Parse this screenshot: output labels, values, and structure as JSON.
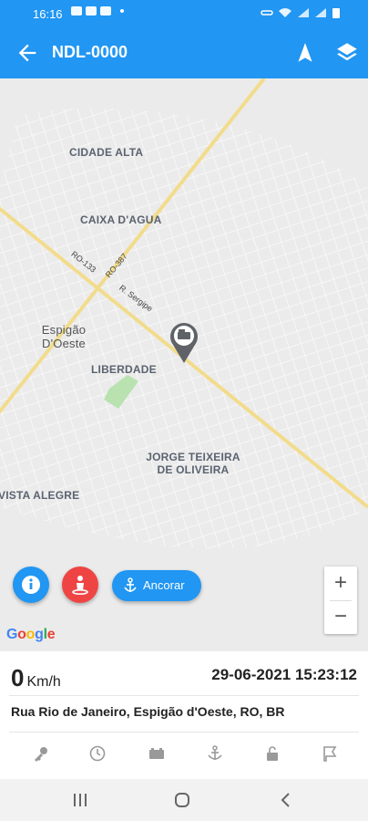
{
  "status_bar": {
    "time": "16:16"
  },
  "app_bar": {
    "title": "NDL-0000"
  },
  "map": {
    "labels": {
      "cidade_alta": "CIDADE ALTA",
      "caixa_dagua": "CAIXA D'AGUA",
      "espigao_doeste": "Espigão D'Oeste",
      "liberdade": "LIBERDADE",
      "jorge_teixeira": "JORGE TEIXEIRA DE OLIVEIRA",
      "vista_alegre": "VISTA ALEGRE"
    },
    "road_labels": {
      "ro133": "RO-133",
      "ro387": "RO-387",
      "r_sergipe": "R. Sergipe"
    },
    "google_logo": "Google",
    "anchor_button": "Ancorar",
    "zoom_in": "+",
    "zoom_out": "−"
  },
  "vehicle": {
    "speed_value": "0",
    "speed_unit": "Km/h",
    "datetime": "29-06-2021 15:23:12",
    "address": "Rua Rio de Janeiro, Espigão d'Oeste, RO, BR"
  },
  "colors": {
    "primary": "#2196f3",
    "danger": "#ef4444",
    "road": "#f2dc8c"
  }
}
